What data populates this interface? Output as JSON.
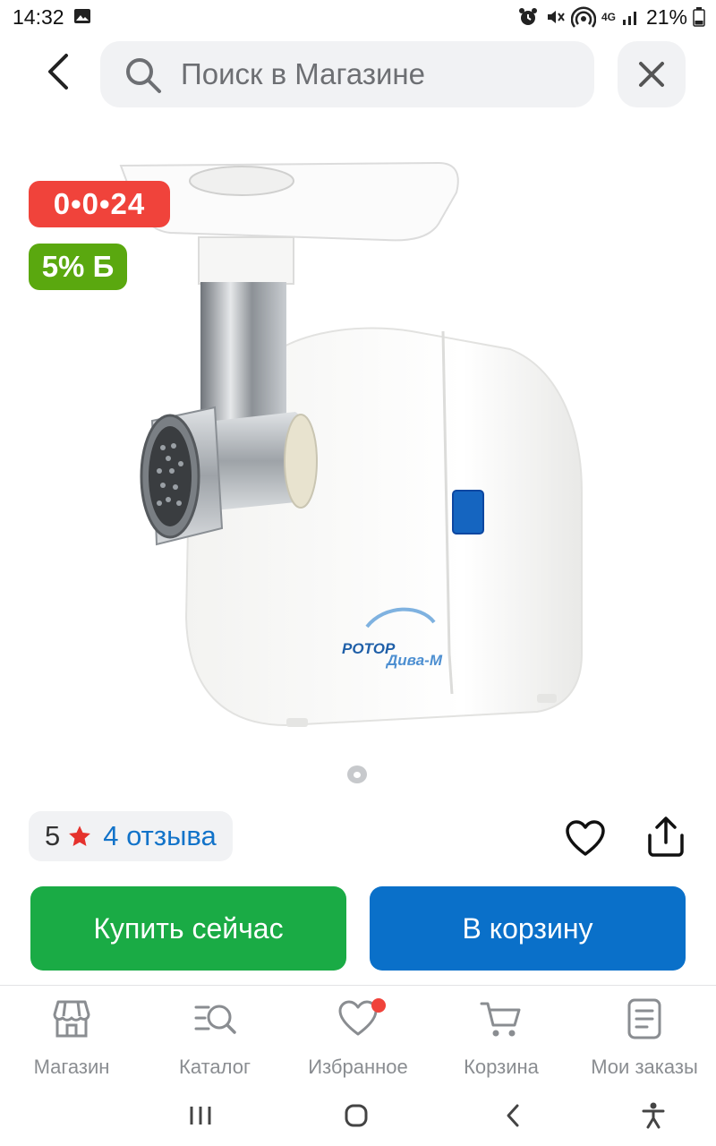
{
  "status_bar": {
    "time": "14:32",
    "battery": "21%",
    "network": "4G",
    "icons": [
      "gallery-icon",
      "alarm-icon",
      "mute-icon",
      "hotspot-icon",
      "signal-icon",
      "battery-icon"
    ]
  },
  "header": {
    "search_placeholder": "Поиск в Магазине",
    "icons": [
      "back-arrow-icon",
      "search-icon",
      "close-icon"
    ]
  },
  "product": {
    "image_label": "РОТОР Дива-М",
    "timer_badge": "0•0•24",
    "bonus_badge": "5% Б",
    "colors": {
      "timer_badge": "#f0433b",
      "bonus_badge": "#5aa80f"
    }
  },
  "rating": {
    "value": "5",
    "reviews": "4 отзыва",
    "star_color": "#e5322d",
    "link_color": "#1273c9"
  },
  "actions": {
    "buy_now": "Купить сейчас",
    "add_to_cart": "В корзину",
    "buy_now_color": "#1aab45",
    "add_to_cart_color": "#0a70c9"
  },
  "bottom_nav": {
    "items": [
      {
        "label": "Магазин",
        "icon": "store-icon"
      },
      {
        "label": "Каталог",
        "icon": "catalog-search-icon"
      },
      {
        "label": "Избранное",
        "icon": "heart-icon"
      },
      {
        "label": "Корзина",
        "icon": "cart-icon"
      },
      {
        "label": "Мои заказы",
        "icon": "orders-icon"
      }
    ]
  },
  "system_nav": {
    "icons": [
      "recent-apps-icon",
      "home-icon",
      "back-icon",
      "accessibility-icon"
    ]
  }
}
